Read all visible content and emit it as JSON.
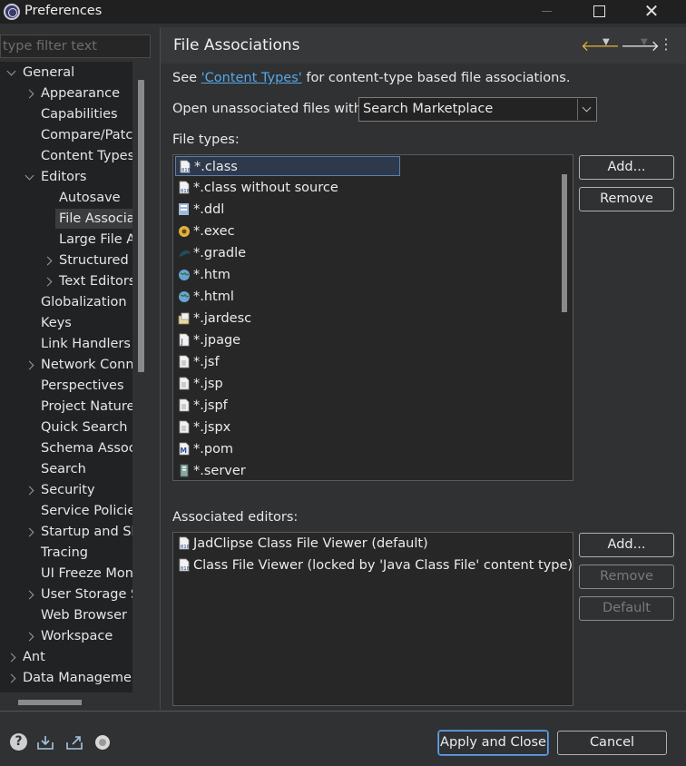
{
  "window": {
    "title": "Preferences",
    "min_glyph": "",
    "close_glyph": "✕"
  },
  "filter": {
    "placeholder": "type filter text"
  },
  "tree": {
    "items": [
      {
        "label": "General",
        "indent": 0,
        "expander": "down"
      },
      {
        "label": "Appearance",
        "indent": 1,
        "expander": "right"
      },
      {
        "label": "Capabilities",
        "indent": 1,
        "expander": ""
      },
      {
        "label": "Compare/Patch",
        "indent": 1,
        "expander": ""
      },
      {
        "label": "Content Types",
        "indent": 1,
        "expander": ""
      },
      {
        "label": "Editors",
        "indent": 1,
        "expander": "down"
      },
      {
        "label": "Autosave",
        "indent": 2,
        "expander": ""
      },
      {
        "label": "File Associations",
        "indent": 2,
        "expander": "",
        "selected": true
      },
      {
        "label": "Large File Associations",
        "indent": 2,
        "expander": ""
      },
      {
        "label": "Structured Text Editors",
        "indent": 2,
        "expander": "right"
      },
      {
        "label": "Text Editors",
        "indent": 2,
        "expander": "right"
      },
      {
        "label": "Globalization",
        "indent": 1,
        "expander": ""
      },
      {
        "label": "Keys",
        "indent": 1,
        "expander": ""
      },
      {
        "label": "Link Handlers",
        "indent": 1,
        "expander": ""
      },
      {
        "label": "Network Connections",
        "indent": 1,
        "expander": "right"
      },
      {
        "label": "Perspectives",
        "indent": 1,
        "expander": ""
      },
      {
        "label": "Project Natures",
        "indent": 1,
        "expander": ""
      },
      {
        "label": "Quick Search",
        "indent": 1,
        "expander": ""
      },
      {
        "label": "Schema Associations",
        "indent": 1,
        "expander": ""
      },
      {
        "label": "Search",
        "indent": 1,
        "expander": ""
      },
      {
        "label": "Security",
        "indent": 1,
        "expander": "right"
      },
      {
        "label": "Service Policies",
        "indent": 1,
        "expander": ""
      },
      {
        "label": "Startup and Shutdown",
        "indent": 1,
        "expander": "right"
      },
      {
        "label": "Tracing",
        "indent": 1,
        "expander": ""
      },
      {
        "label": "UI Freeze Monitoring",
        "indent": 1,
        "expander": ""
      },
      {
        "label": "User Storage Service",
        "indent": 1,
        "expander": "right"
      },
      {
        "label": "Web Browser",
        "indent": 1,
        "expander": ""
      },
      {
        "label": "Workspace",
        "indent": 1,
        "expander": "right"
      },
      {
        "label": "Ant",
        "indent": 0,
        "expander": "right"
      },
      {
        "label": "Data Management",
        "indent": 0,
        "expander": "right"
      }
    ]
  },
  "page": {
    "title": "File Associations",
    "see_prefix": "See ",
    "content_types_link": "'Content Types'",
    "see_suffix": " for content-type based file associations.",
    "open_unassociated_label": "Open unassociated files with:",
    "open_unassociated_value": "Search Marketplace",
    "file_types_label": "File types:",
    "associated_editors_label": "Associated editors:"
  },
  "nav": {
    "back_glyph": "🡐",
    "fwd_glyph": "🡒",
    "menu_glyph": "▼",
    "view_menu_glyph": "⋮"
  },
  "file_types": [
    {
      "name": "*.class",
      "icon": "class-file-icon",
      "selected": true
    },
    {
      "name": "*.class without source",
      "icon": "class-file-icon"
    },
    {
      "name": "*.ddl",
      "icon": "ddl-file-icon"
    },
    {
      "name": "*.exec",
      "icon": "exec-file-icon"
    },
    {
      "name": "*.gradle",
      "icon": "gradle-icon"
    },
    {
      "name": "*.htm",
      "icon": "globe-icon"
    },
    {
      "name": "*.html",
      "icon": "globe-icon"
    },
    {
      "name": "*.jardesc",
      "icon": "jardesc-icon"
    },
    {
      "name": "*.jpage",
      "icon": "jpage-icon"
    },
    {
      "name": "*.jsf",
      "icon": "text-file-icon"
    },
    {
      "name": "*.jsp",
      "icon": "text-file-icon"
    },
    {
      "name": "*.jspf",
      "icon": "text-file-icon"
    },
    {
      "name": "*.jspx",
      "icon": "text-file-icon"
    },
    {
      "name": "*.pom",
      "icon": "maven-pom-icon"
    },
    {
      "name": "*.server",
      "icon": "server-icon"
    }
  ],
  "file_type_buttons": {
    "add": "Add...",
    "remove": "Remove"
  },
  "editors": [
    {
      "name": "JadClipse Class File Viewer (default)",
      "icon": "class-viewer-icon"
    },
    {
      "name": "Class File Viewer (locked by 'Java Class File' content type)",
      "icon": "class-viewer-icon"
    }
  ],
  "editor_buttons": {
    "add": "Add...",
    "remove": "Remove",
    "default": "Default"
  },
  "footer": {
    "help_glyph": "?",
    "apply_close": "Apply and Close",
    "cancel": "Cancel"
  },
  "colors": {
    "accent_link": "#57a8e8",
    "background": "#2f3133",
    "list_bg": "#272727"
  }
}
